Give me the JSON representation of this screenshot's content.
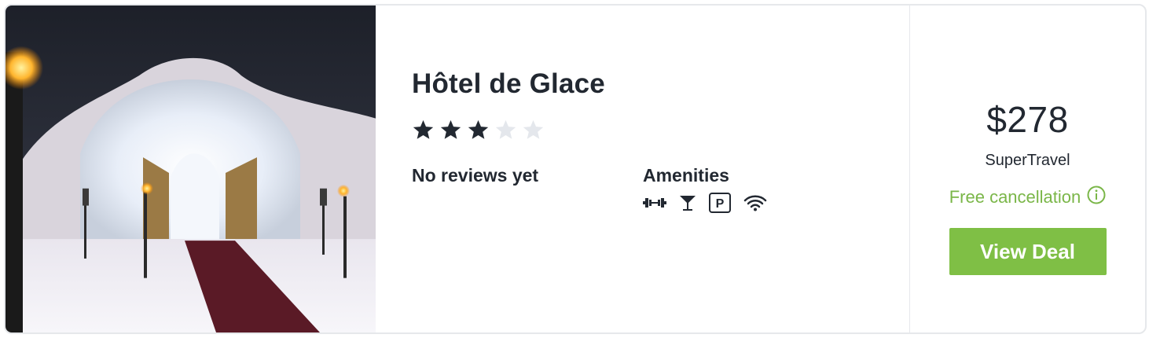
{
  "hotel": {
    "name": "Hôtel de Glace",
    "star_rating": 3,
    "star_max": 5,
    "reviews_text": "No reviews yet",
    "amenities_title": "Amenities",
    "amenities": [
      "fitness-icon",
      "bar-icon",
      "parking-icon",
      "wifi-icon"
    ],
    "parking_letter": "P"
  },
  "deal": {
    "price": "$278",
    "provider": "SuperTravel",
    "cancellation": "Free cancellation",
    "button_label": "View Deal"
  },
  "colors": {
    "text": "#222831",
    "star_empty": "#e4e7ec",
    "accent_green": "#7ab648",
    "button_green": "#7fbf45",
    "border": "#e6e8eb"
  }
}
